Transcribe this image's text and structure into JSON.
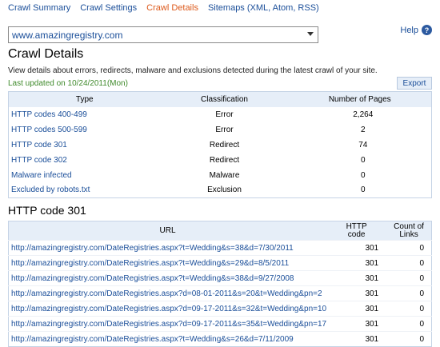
{
  "nav": {
    "tabs": [
      {
        "label": "Crawl Summary"
      },
      {
        "label": "Crawl Settings"
      },
      {
        "label": "Crawl Details"
      },
      {
        "label": "Sitemaps (XML, Atom, RSS)"
      }
    ],
    "active_tab": "Crawl Details"
  },
  "site_selector": {
    "value": "www.amazingregistry.com"
  },
  "help": {
    "label": "Help",
    "icon": "question-icon"
  },
  "page": {
    "title": "Crawl Details",
    "description": "View details about errors, redirects, malware and exclusions detected during the latest crawl of your site.",
    "last_updated": "Last updated on 10/24/2011(Mon)",
    "export_label": "Export"
  },
  "summary_table": {
    "headers": [
      "Type",
      "Classification",
      "Number of Pages"
    ],
    "rows": [
      {
        "type": "HTTP codes 400-499",
        "classification": "Error",
        "pages": "2,264"
      },
      {
        "type": "HTTP codes 500-599",
        "classification": "Error",
        "pages": "2"
      },
      {
        "type": "HTTP code 301",
        "classification": "Redirect",
        "pages": "74"
      },
      {
        "type": "HTTP code 302",
        "classification": "Redirect",
        "pages": "0"
      },
      {
        "type": "Malware infected",
        "classification": "Malware",
        "pages": "0"
      },
      {
        "type": "Excluded by robots.txt",
        "classification": "Exclusion",
        "pages": "0"
      }
    ]
  },
  "detail": {
    "title": "HTTP code 301",
    "headers": {
      "url": "URL",
      "http_code_1": "HTTP",
      "http_code_2": "code",
      "count_1": "Count of",
      "count_2": "Links"
    },
    "rows": [
      {
        "url": "http://amazingregistry.com/DateRegistries.aspx?t=Wedding&s=38&d=7/30/2011",
        "code": "301",
        "count": "0"
      },
      {
        "url": "http://amazingregistry.com/DateRegistries.aspx?t=Wedding&s=29&d=8/5/2011",
        "code": "301",
        "count": "0"
      },
      {
        "url": "http://amazingregistry.com/DateRegistries.aspx?t=Wedding&s=38&d=9/27/2008",
        "code": "301",
        "count": "0"
      },
      {
        "url": "http://amazingregistry.com/DateRegistries.aspx?d=08-01-2011&s=20&t=Wedding&pn=2",
        "code": "301",
        "count": "0"
      },
      {
        "url": "http://amazingregistry.com/DateRegistries.aspx?d=09-17-2011&s=32&t=Wedding&pn=10",
        "code": "301",
        "count": "0"
      },
      {
        "url": "http://amazingregistry.com/DateRegistries.aspx?d=09-17-2011&s=35&t=Wedding&pn=17",
        "code": "301",
        "count": "0"
      },
      {
        "url": "http://amazingregistry.com/DateRegistries.aspx?t=Wedding&s=26&d=7/11/2009",
        "code": "301",
        "count": "0"
      }
    ]
  },
  "colors": {
    "link": "#1a4e99",
    "active_tab": "#dd5a1c",
    "updated_text": "#3f8a2b",
    "header_bg": "#e6eef8"
  }
}
